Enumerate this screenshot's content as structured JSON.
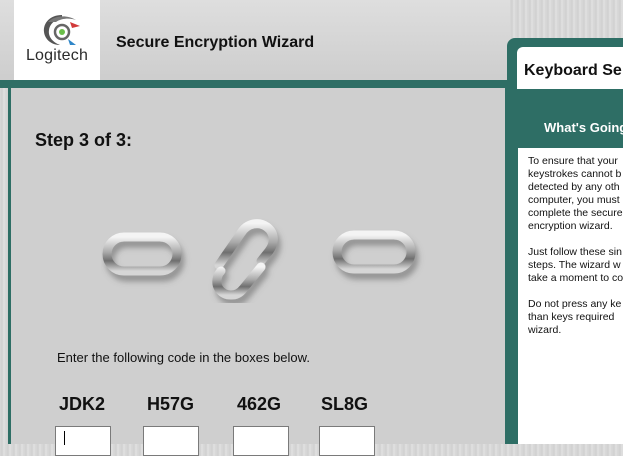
{
  "header": {
    "logo_text": "Logitech",
    "title": "Secure Encryption Wizard"
  },
  "main": {
    "step": "Step 3 of 3:",
    "instruction": "Enter the following code in the boxes below.",
    "codes": [
      "JDK2",
      "H57G",
      "462G",
      "SL8G"
    ],
    "inputs": [
      "",
      "",
      "",
      ""
    ]
  },
  "side": {
    "header": "Keyboard Se",
    "subheader": "What's Going",
    "paragraph1_lines": [
      "To ensure that your",
      "keystrokes cannot b",
      "detected by any oth",
      "computer, you must",
      "complete the secure",
      "encryption wizard."
    ],
    "paragraph2_lines": [
      "Just follow these sin",
      "steps. The wizard w",
      "take a moment to co"
    ],
    "paragraph3_lines": [
      "Do not press any ke",
      "than keys required",
      "wizard."
    ]
  },
  "colors": {
    "accent_teal": "#2e6e65",
    "panel_gray": "#cfcfcf"
  },
  "icons": {
    "logo": "logitech-logo-icon",
    "chain": "broken-chain-icon"
  }
}
